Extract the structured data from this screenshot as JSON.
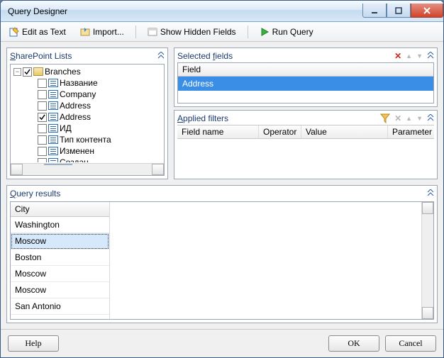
{
  "window": {
    "title": "Query Designer"
  },
  "toolbar": {
    "edit_as_text": "Edit as Text",
    "import": "Import...",
    "show_hidden": "Show Hidden Fields",
    "run_query": "Run Query"
  },
  "sharepoint": {
    "title_prefix": "S",
    "title_rest": "harePoint Lists",
    "root": "Branches",
    "items": [
      {
        "label": "Название",
        "checked": false
      },
      {
        "label": "Company",
        "checked": false
      },
      {
        "label": "Address",
        "checked": false
      },
      {
        "label": "Address",
        "checked": true
      },
      {
        "label": "ИД",
        "checked": false
      },
      {
        "label": "Тип контента",
        "checked": false
      },
      {
        "label": "Изменен",
        "checked": false
      },
      {
        "label": "Создан",
        "checked": false
      }
    ]
  },
  "selected_fields": {
    "title_prefix": "f",
    "title_pre": "Selected ",
    "title_rest": "ields",
    "col_field": "Field",
    "rows": [
      "Address"
    ]
  },
  "applied_filters": {
    "title_prefix": "A",
    "title_rest": "pplied filters",
    "cols": {
      "field_name": "Field name",
      "operator": "Operator",
      "value": "Value",
      "parameter": "Parameter"
    }
  },
  "results": {
    "title_prefix": "Q",
    "title_rest": "uery results",
    "col": "City",
    "rows": [
      "Washington",
      "Moscow",
      "Boston",
      "Moscow",
      "Moscow",
      "San Antonio"
    ],
    "selected_index": 1
  },
  "footer": {
    "help": "Help",
    "ok": "OK",
    "cancel": "Cancel"
  },
  "icons": {
    "delete": "✕",
    "up": "▲",
    "down": "▼",
    "chev": "▲"
  }
}
